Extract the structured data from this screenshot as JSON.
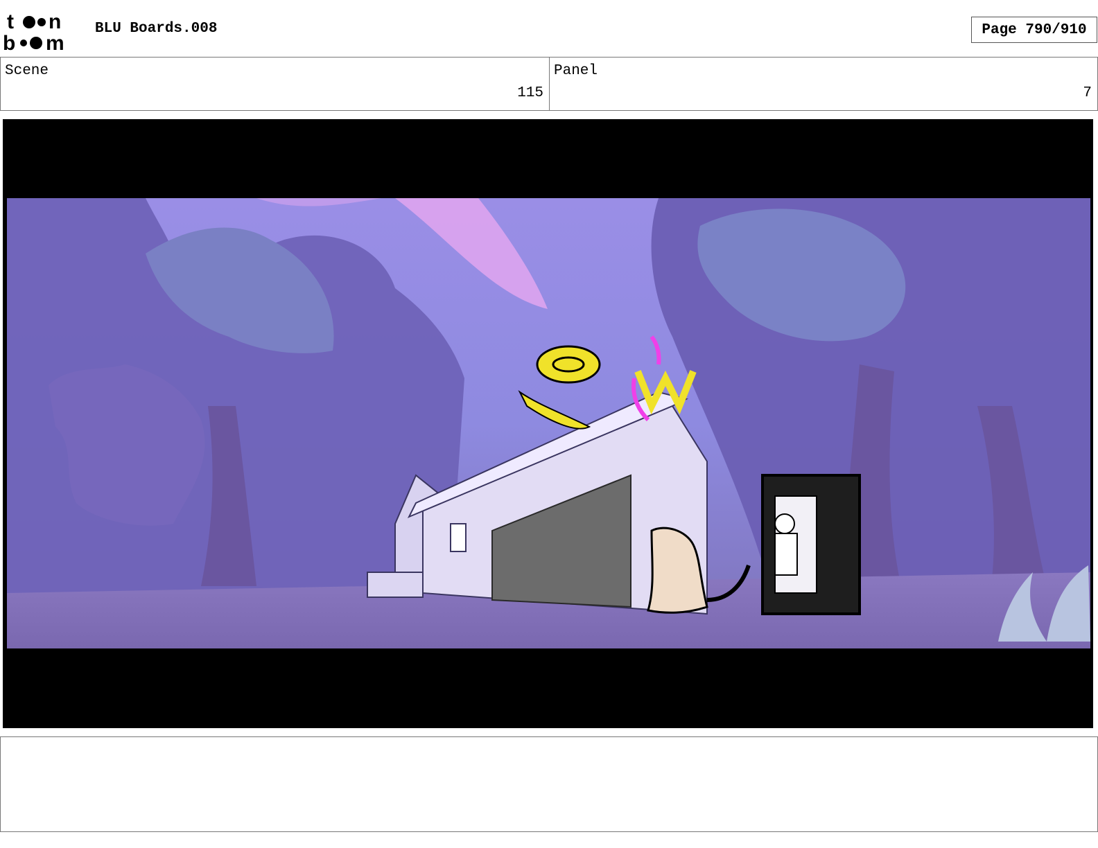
{
  "header": {
    "logo_top": "t●●n",
    "logo_bottom": "b●●m",
    "title": "BLU Boards.008",
    "page_label": "Page 790/910"
  },
  "info": {
    "scene_label": "Scene",
    "scene_value": "115",
    "panel_label": "Panel",
    "panel_value": "7"
  },
  "notes": {
    "text": ""
  }
}
